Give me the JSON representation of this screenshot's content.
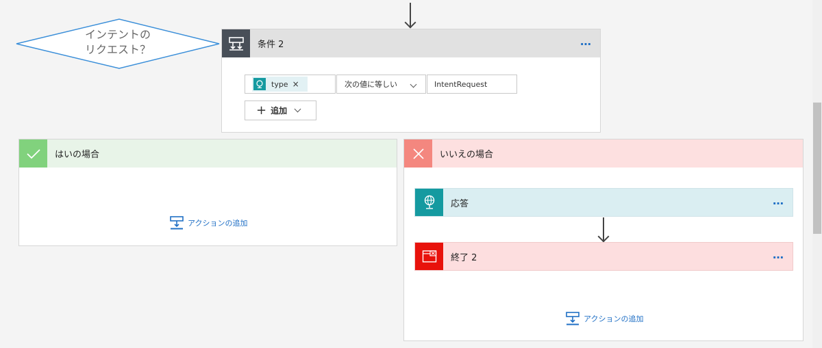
{
  "diamond": {
    "text": "インテントの\nリクエスト？"
  },
  "condition": {
    "title": "条件 2",
    "menu": "…",
    "token_label": "type",
    "token_remove": "×",
    "operator": "次の値に等しい",
    "value": "IntentRequest",
    "add_label": "追加",
    "add_plus": "+"
  },
  "yes_branch": {
    "title": "はいの場合",
    "add_action": "アクションの追加"
  },
  "no_branch": {
    "title": "いいえの場合",
    "response_title": "応答",
    "terminate_title": "終了 2",
    "menu": "…",
    "add_action": "アクションの追加"
  },
  "colors": {
    "condition_header": "#e1e1e1",
    "condition_icon": "#484f58",
    "yes_header": "#e8f4e8",
    "yes_icon": "#81d27d",
    "no_header": "#fde0e0",
    "no_icon": "#f4877f",
    "response_bg": "#daeef2",
    "response_icon": "#159aa0",
    "terminate_bg": "#fddedf",
    "terminate_icon": "#e8120c",
    "accent": "#1f6fc5"
  }
}
